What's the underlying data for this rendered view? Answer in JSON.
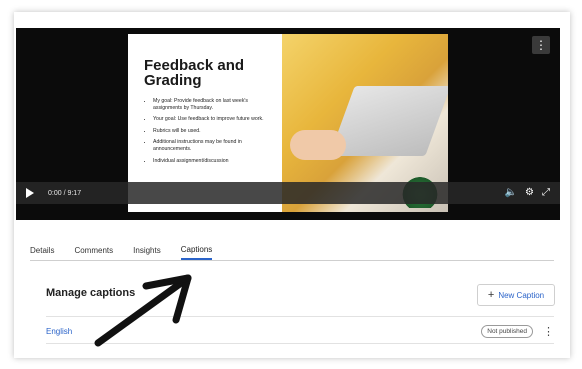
{
  "player": {
    "slide": {
      "title": "Feedback and Grading",
      "bullets": [
        "My goal: Provide feedback on last week's assignments by Thursday.",
        "Your goal: Use feedback to improve future work.",
        "Rubrics will be used.",
        "Additional instructions may be found in announcements.",
        "Individual assignment/discussion"
      ]
    },
    "time": "0:00 / 9:17",
    "menu_icon": "kebab-icon",
    "icons": [
      "play-icon",
      "volume-icon",
      "settings-icon",
      "fullscreen-icon"
    ]
  },
  "tabs": [
    {
      "label": "Details"
    },
    {
      "label": "Comments"
    },
    {
      "label": "Insights"
    },
    {
      "label": "Captions"
    }
  ],
  "active_tab": "Captions",
  "captions": {
    "title": "Manage captions",
    "new_button": "New Caption",
    "rows": [
      {
        "language": "English",
        "status": "Not published"
      }
    ]
  },
  "colors": {
    "accent": "#2a63c9",
    "annotation_arrow": "#111111"
  }
}
